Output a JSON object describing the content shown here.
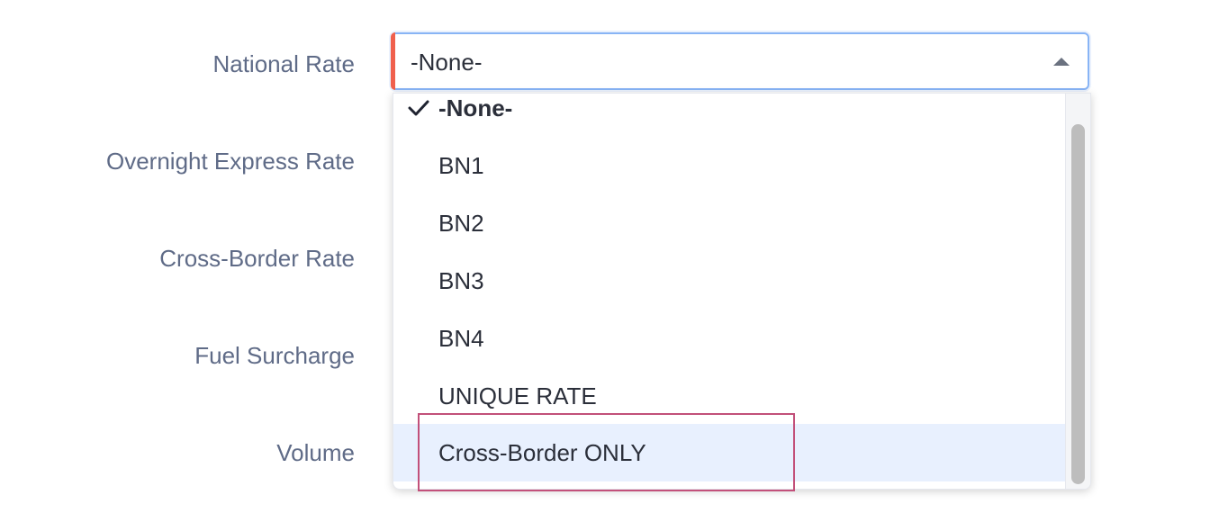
{
  "form": {
    "labels": [
      "National Rate",
      "Overnight Express Rate",
      "Cross-Border Rate",
      "Fuel Surcharge",
      "Volume"
    ]
  },
  "select": {
    "value": "-None-"
  },
  "dropdown": {
    "options": [
      "-None-",
      "BN1",
      "BN2",
      "BN3",
      "BN4",
      "UNIQUE RATE",
      "Cross-Border ONLY"
    ],
    "selected_index": 0,
    "highlighted_index": 6
  },
  "icons": {
    "check": "check-icon",
    "caret": "caret-up-icon"
  },
  "colors": {
    "label_text": "#5f6b87",
    "required_bar": "#f0604d",
    "focus_border": "#88b4f5",
    "highlight_bg": "#e8f0fe",
    "annotation_border": "#c2507a"
  }
}
